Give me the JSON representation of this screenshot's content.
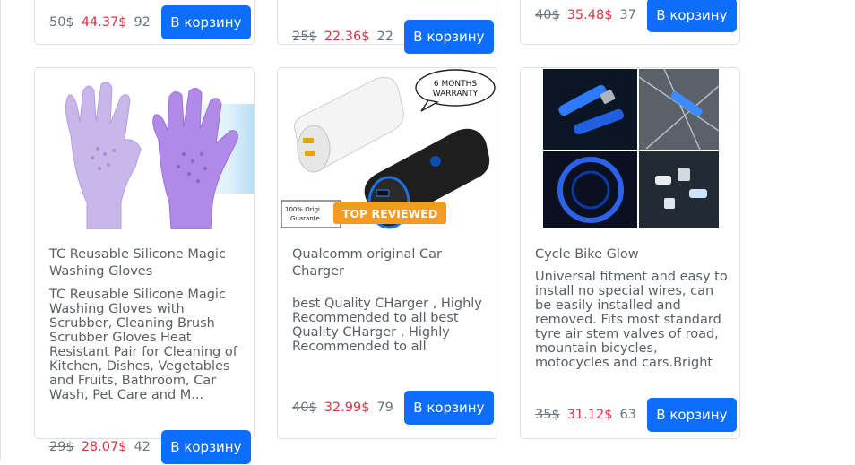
{
  "top_row": [
    {
      "old_price": "50$",
      "new_price": "44.37$",
      "qty": "92",
      "button": "В корзину"
    },
    {
      "old_price": "25$",
      "new_price": "22.36$",
      "qty": "22",
      "button": "В корзину"
    },
    {
      "old_price": "40$",
      "new_price": "35.48$",
      "qty": "37",
      "button": "В корзину"
    }
  ],
  "products": [
    {
      "title": "TC Reusable Silicone Magic Washing Gloves",
      "description": "TC Reusable Silicone Magic Washing Gloves with Scrubber, Cleaning Brush Scrubber Gloves Heat Resistant Pair for Cleaning of Kitchen, Dishes, Vegetables and Fruits, Bathroom, Car Wash, Pet Care and M...",
      "old_price": "29$",
      "new_price": "28.07$",
      "qty": "42",
      "button": "В корзину"
    },
    {
      "title": "Qualcomm original Car Charger",
      "description": "best Quality CHarger , Highly Recommended to all best Quality CHarger , Highly Recommended to all",
      "image_text": {
        "warranty_line1": "6 MONTHS",
        "warranty_line2": "WARRANTY",
        "badge": "TOP REVIEWED",
        "seal_line1": "100% Origi",
        "seal_line2": "Guarante"
      },
      "old_price": "40$",
      "new_price": "32.99$",
      "qty": "79",
      "button": "В корзину"
    },
    {
      "title": "Cycle Bike Glow",
      "description": "Universal fitment and easy to install no special wires, can be easily installed and removed. Fits most standard tyre air stem valves of road, mountain bicycles, motocycles and cars.Bright led will t...",
      "old_price": "35$",
      "new_price": "31.12$",
      "qty": "63",
      "button": "В корзину"
    }
  ],
  "colors": {
    "button": "#0d6efd",
    "sale_price": "#dc3545",
    "muted": "#6c757d"
  }
}
